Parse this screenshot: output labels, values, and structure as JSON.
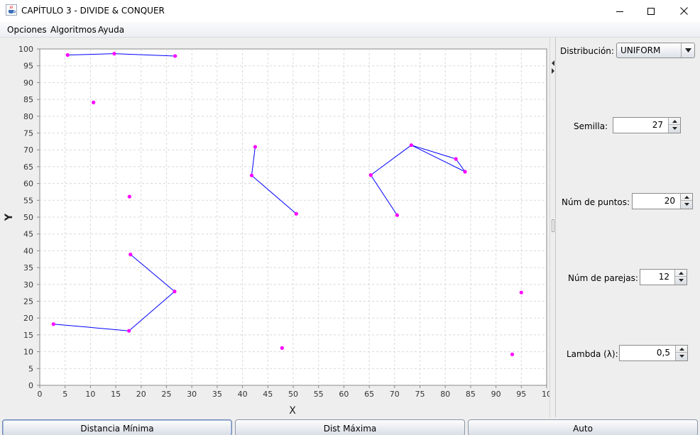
{
  "window": {
    "title": "CAPÍTULO 3 - DIVIDE & CONQUER",
    "icons": [
      "java-cup-icon",
      "minimize-icon",
      "maximize-icon",
      "close-icon"
    ]
  },
  "menu": {
    "items": [
      "Opciones",
      "Algoritmos",
      "Ayuda"
    ]
  },
  "chart_data": {
    "type": "scatter",
    "xlabel": "X",
    "ylabel": "Y",
    "xlim": [
      0,
      100
    ],
    "ylim": [
      0,
      100
    ],
    "xticks": [
      "0",
      "5",
      "10",
      "15",
      "20",
      "25",
      "30",
      "35",
      "40",
      "45",
      "50",
      "55",
      "60",
      "65",
      "70",
      "75",
      "80",
      "85",
      "90",
      "95",
      "10"
    ],
    "yticks": [
      "0",
      "5",
      "10",
      "15",
      "20",
      "25",
      "30",
      "35",
      "40",
      "45",
      "50",
      "55",
      "60",
      "65",
      "70",
      "75",
      "80",
      "85",
      "90",
      "95",
      "100"
    ],
    "grid": true,
    "point_color": "#ff00ff",
    "line_color": "#0000ff",
    "points": [
      [
        5.5,
        98.2
      ],
      [
        14.7,
        98.6
      ],
      [
        26.7,
        97.9
      ],
      [
        10.6,
        84.1
      ],
      [
        17.7,
        56.1
      ],
      [
        42.5,
        70.9
      ],
      [
        41.8,
        62.4
      ],
      [
        50.6,
        51.0
      ],
      [
        65.3,
        62.5
      ],
      [
        73.3,
        71.4
      ],
      [
        82.1,
        67.3
      ],
      [
        83.9,
        63.5
      ],
      [
        70.5,
        50.6
      ],
      [
        17.9,
        38.9
      ],
      [
        26.6,
        27.9
      ],
      [
        2.7,
        18.2
      ],
      [
        17.6,
        16.2
      ],
      [
        47.8,
        11.1
      ],
      [
        95.0,
        27.6
      ],
      [
        93.2,
        9.2
      ]
    ],
    "segments": [
      [
        [
          5.5,
          98.2
        ],
        [
          14.7,
          98.6
        ]
      ],
      [
        [
          14.7,
          98.6
        ],
        [
          26.7,
          97.9
        ]
      ],
      [
        [
          42.5,
          70.9
        ],
        [
          41.8,
          62.4
        ]
      ],
      [
        [
          41.8,
          62.4
        ],
        [
          50.6,
          51.0
        ]
      ],
      [
        [
          65.3,
          62.5
        ],
        [
          73.3,
          71.4
        ]
      ],
      [
        [
          73.3,
          71.4
        ],
        [
          82.1,
          67.3
        ]
      ],
      [
        [
          82.1,
          67.3
        ],
        [
          83.9,
          63.5
        ]
      ],
      [
        [
          73.3,
          71.4
        ],
        [
          83.9,
          63.5
        ]
      ],
      [
        [
          65.3,
          62.5
        ],
        [
          70.5,
          50.6
        ]
      ],
      [
        [
          17.9,
          38.9
        ],
        [
          26.6,
          27.9
        ]
      ],
      [
        [
          26.6,
          27.9
        ],
        [
          17.6,
          16.2
        ]
      ],
      [
        [
          17.6,
          16.2
        ],
        [
          2.7,
          18.2
        ]
      ]
    ]
  },
  "panel": {
    "distribucion_label": "Distribución:",
    "distribucion_value": "UNIFORM",
    "semilla_label": "Semilla:",
    "semilla_value": "27",
    "puntos_label": "Núm de puntos:",
    "puntos_value": "20",
    "parejas_label": "Núm de parejas:",
    "parejas_value": "12",
    "lambda_label": "Lambda (λ):",
    "lambda_value": "0,5"
  },
  "buttons": {
    "min": "Distancia Mínima",
    "max": "Dist Máxima",
    "auto": "Auto"
  }
}
